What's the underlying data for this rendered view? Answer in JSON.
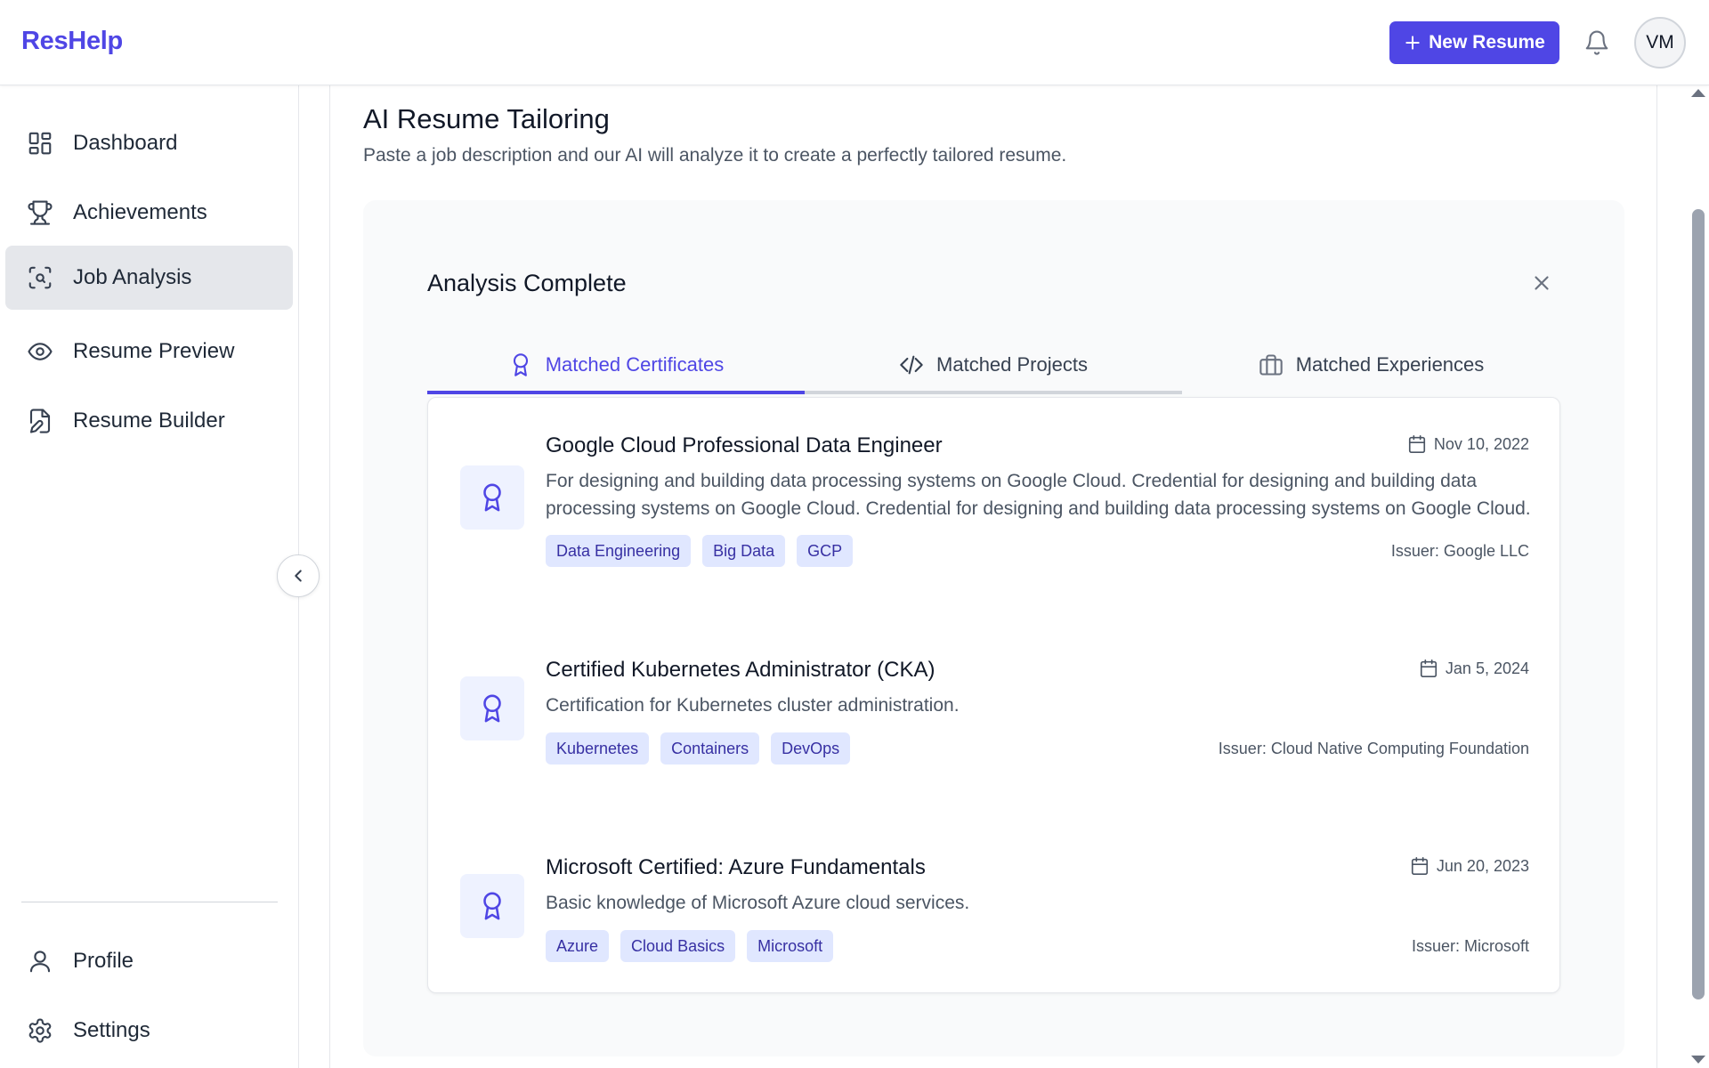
{
  "header": {
    "brand": "ResHelp",
    "new_resume_label": "New Resume",
    "avatar_initials": "VM"
  },
  "sidebar": {
    "items": [
      {
        "label": "Dashboard",
        "icon": "dashboard-icon"
      },
      {
        "label": "Achievements",
        "icon": "trophy-icon"
      },
      {
        "label": "Job Analysis",
        "icon": "scan-search-icon",
        "active": true
      },
      {
        "label": "Resume Preview",
        "icon": "eye-icon"
      },
      {
        "label": "Resume Builder",
        "icon": "file-edit-icon"
      }
    ],
    "bottom_items": [
      {
        "label": "Profile",
        "icon": "user-icon"
      },
      {
        "label": "Settings",
        "icon": "gear-icon"
      }
    ]
  },
  "main": {
    "title": "AI Resume Tailoring",
    "subtitle": "Paste a job description and our AI will analyze it to create a perfectly tailored resume.",
    "analysis": {
      "title": "Analysis Complete",
      "tabs": [
        {
          "label": "Matched Certificates",
          "icon": "award-icon",
          "active": true
        },
        {
          "label": "Matched Projects",
          "icon": "code-icon"
        },
        {
          "label": "Matched Experiences",
          "icon": "briefcase-icon"
        }
      ],
      "certificates": [
        {
          "name": "Google Cloud Professional Data Engineer",
          "date": "Nov 10, 2022",
          "description": "For designing and building data processing systems on Google Cloud. Credential for designing and building data processing systems on Google Cloud. Credential for designing and building data processing systems on Google Cloud.",
          "tags": [
            "Data Engineering",
            "Big Data",
            "GCP"
          ],
          "issuer": "Issuer: Google LLC"
        },
        {
          "name": "Certified Kubernetes Administrator (CKA)",
          "date": "Jan 5, 2024",
          "description": "Certification for Kubernetes cluster administration.",
          "tags": [
            "Kubernetes",
            "Containers",
            "DevOps"
          ],
          "issuer": "Issuer: Cloud Native Computing Foundation"
        },
        {
          "name": "Microsoft Certified: Azure Fundamentals",
          "date": "Jun 20, 2023",
          "description": "Basic knowledge of Microsoft Azure cloud services.",
          "tags": [
            "Azure",
            "Cloud Basics",
            "Microsoft"
          ],
          "issuer": "Issuer: Microsoft"
        }
      ]
    }
  },
  "colors": {
    "accent": "#4f46e5",
    "tag_bg": "#e0e7ff",
    "tag_text": "#3730a3",
    "active_nav_bg": "#e5e7eb"
  }
}
